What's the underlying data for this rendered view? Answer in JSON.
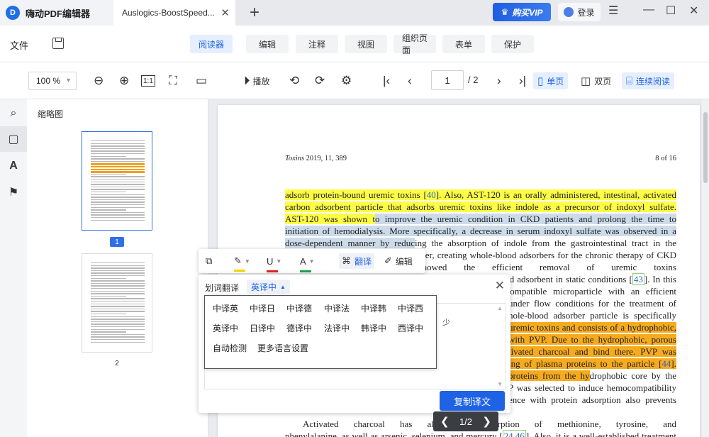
{
  "titlebar": {
    "app_title": "嗨动PDF编辑器",
    "doc_tab": "Auslogics-BoostSpeed...",
    "close_glyph": "✕",
    "new_tab_glyph": "+",
    "vip_label": "购买VIP",
    "login_label": "登录",
    "menu_glyph": "☰",
    "minimize_glyph": "—",
    "maximize_glyph": "☐",
    "window_close_glyph": "✕"
  },
  "menubar": {
    "file": "文件",
    "tabs": [
      "阅读器",
      "编辑",
      "注释",
      "视图",
      "组织页面",
      "表单",
      "保护"
    ],
    "active_tab": "阅读器"
  },
  "toolbar": {
    "zoom": "100 %",
    "play_label": "播放",
    "current_page": "1",
    "total_pages": "/ 2",
    "single_page": "单页",
    "double_page": "双页",
    "continuous": "连续阅读",
    "fit_label": "1:1"
  },
  "sidebar": {
    "title": "缩略图",
    "thumbnails": [
      {
        "label": "1",
        "selected": true
      },
      {
        "label": "2",
        "selected": false
      }
    ]
  },
  "document": {
    "running_head_journal": "Toxins",
    "running_head_rest": " 2019, 11, 389",
    "running_head_year": "2019",
    "page_label": "8 of 16",
    "lines": [
      {
        "segments": [
          {
            "t": "adsorb protein-bound uremic toxins [",
            "h": "yellow"
          },
          {
            "t": "40",
            "h": "yellow-ref"
          },
          {
            "t": "].  Also, AST-120 is an orally administered, intestinal, activated",
            "h": "yellow"
          }
        ]
      },
      {
        "segments": [
          {
            "t": "carbon adsorbent particle that adsorbs uremic toxins like indole as a precursor of indoxyl sulfate.",
            "h": "yellow"
          }
        ]
      },
      {
        "segments": [
          {
            "t": "AST-120 was shown t",
            "h": "yellow"
          },
          {
            "t": "o improve the uremic condition in CKD patients and prolong the time to",
            "h": "blue"
          }
        ]
      },
      {
        "segments": [
          {
            "t": "initiation of hemodialysis.  More specifically, a decrease in serum indoxyl sulfate was observed in a",
            "h": "blue"
          }
        ]
      },
      {
        "segments": [
          {
            "t": "dose-dependent manner by reduc",
            "h": "blue"
          },
          {
            "t": "ing the absorption of indole from the gastrointestinal tract in the",
            "h": ""
          }
        ]
      },
      {
        "segments": [
          {
            "t": "presence of AST-120 [41,42].  However, creating whole-blood adsorbers for the chronic therapy of CKD",
            "h": ""
          }
        ]
      },
      {
        "segments": [
          {
            "t": "",
            "h": ""
          },
          {
            "t": "ntly, Pavlenko et al.  showed the efficient removal of uremic toxins",
            "h": ""
          }
        ]
      },
      {
        "segments": [
          {
            "t": "from human plasma after 4 h incubation with a carbon-based adsorbent in static conditions [",
            "h": ""
          },
          {
            "t": "43",
            "h": "ref-box"
          },
          {
            "t": "].  In this",
            "h": ""
          }
        ]
      },
      {
        "segments": [
          {
            "t": "ocompatible microparticle with an efficient",
            "h": ""
          }
        ]
      },
      {
        "segments": [
          {
            "t": "under flow conditions for the treatment of",
            "h": ""
          }
        ]
      },
      {
        "segments": [
          {
            "t": "hole-blood adsorber particle is specifically",
            "h": ""
          }
        ]
      },
      {
        "segments": [
          {
            "t": "uremic toxins and consists of a hydrophobic,",
            "h": "orange"
          }
        ]
      },
      {
        "segments": [
          {
            "t": "with PVP. Due to the hydrophobic, porous",
            "h": "orange"
          }
        ]
      },
      {
        "segments": [
          {
            "t": "tivated charcoal and bind there.  PVP was",
            "h": "orange"
          }
        ]
      },
      {
        "segments": [
          {
            "t": "ing of plasma proteins to the particle [",
            "h": "orange"
          },
          {
            "t": "44",
            "h": "orange-ref"
          },
          {
            "t": "].",
            "h": "orange"
          }
        ]
      },
      {
        "segments": [
          {
            "t": "proteins from the hy",
            "h": "orange"
          },
          {
            "t": "drophobic core by the",
            "h": ""
          }
        ]
      },
      {
        "segments": [
          {
            "t": "P was selected to induce hemocompatibility",
            "h": ""
          }
        ]
      },
      {
        "segments": [
          {
            "t": "ence with protein adsorption also prevents",
            "h": ""
          }
        ]
      },
      {
        "segments": [
          {
            "t": "",
            "h": ""
          }
        ]
      },
      {
        "segments": [
          {
            "t": "    Activated charcoal has already",
            "h": ""
          },
          {
            "t": "the adsorption of methionine, tyrosine, and",
            "h": ""
          }
        ]
      },
      {
        "segments": [
          {
            "t": "phenylalanine, as well as arsenic, selenium, and mercury [",
            "h": ""
          },
          {
            "t": "24,46",
            "h": "ref-box"
          },
          {
            "t": "].  Also, it is a well-established treatment",
            "h": ""
          }
        ]
      }
    ]
  },
  "float_toolbar": {
    "translate": "翻译",
    "edit": "编辑",
    "colors": {
      "highlight": "#f5d400",
      "underline": "#e02020",
      "text": "#1aa34a"
    }
  },
  "translation": {
    "title": "划词翻译",
    "selected_lang": "英译中",
    "box_text": "少",
    "copy_button": "复制译文",
    "options": [
      [
        "中译英",
        "中译日",
        "中译德",
        "中译法",
        "中译韩",
        "中译西"
      ],
      [
        "英译中",
        "日译中",
        "德译中",
        "法译中",
        "韩译中",
        "西译中"
      ],
      [
        "自动检测",
        "更多语言设置"
      ]
    ]
  },
  "page_nav": {
    "indicator": "1/2"
  }
}
